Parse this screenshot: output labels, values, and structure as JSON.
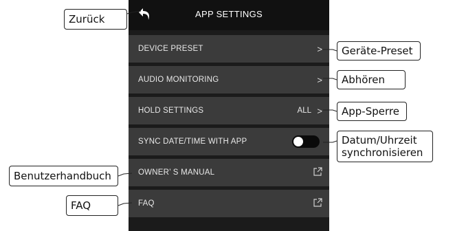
{
  "app": {
    "title": "APP SETTINGS",
    "back_icon": "back-arrow-icon"
  },
  "settings": [
    {
      "label": "DEVICE PRESET",
      "value": "",
      "control": "chevron"
    },
    {
      "label": "AUDIO MONITORING",
      "value": "",
      "control": "chevron"
    },
    {
      "label": "HOLD SETTINGS",
      "value": "ALL",
      "control": "chevron"
    },
    {
      "label": "SYNC DATE/TIME WITH APP",
      "value": "",
      "control": "toggle",
      "toggle_on": false
    },
    {
      "label": "OWNER’ S MANUAL",
      "value": "",
      "control": "external-link"
    },
    {
      "label": "FAQ",
      "value": "",
      "control": "external-link"
    }
  ],
  "callouts": {
    "back": "Zurück",
    "device_preset": "Geräte-Preset",
    "audio_monitoring": "Abhören",
    "hold_settings": "App-Sperre",
    "sync_line1": "Datum/Uhrzeit",
    "sync_line2": "synchronisieren",
    "owners_manual": "Benutzerhandbuch",
    "faq": "FAQ"
  },
  "colors": {
    "panel_bg": "#1b1b1b",
    "row_bg": "#3b3b3b",
    "text": "#e8e8e8"
  }
}
